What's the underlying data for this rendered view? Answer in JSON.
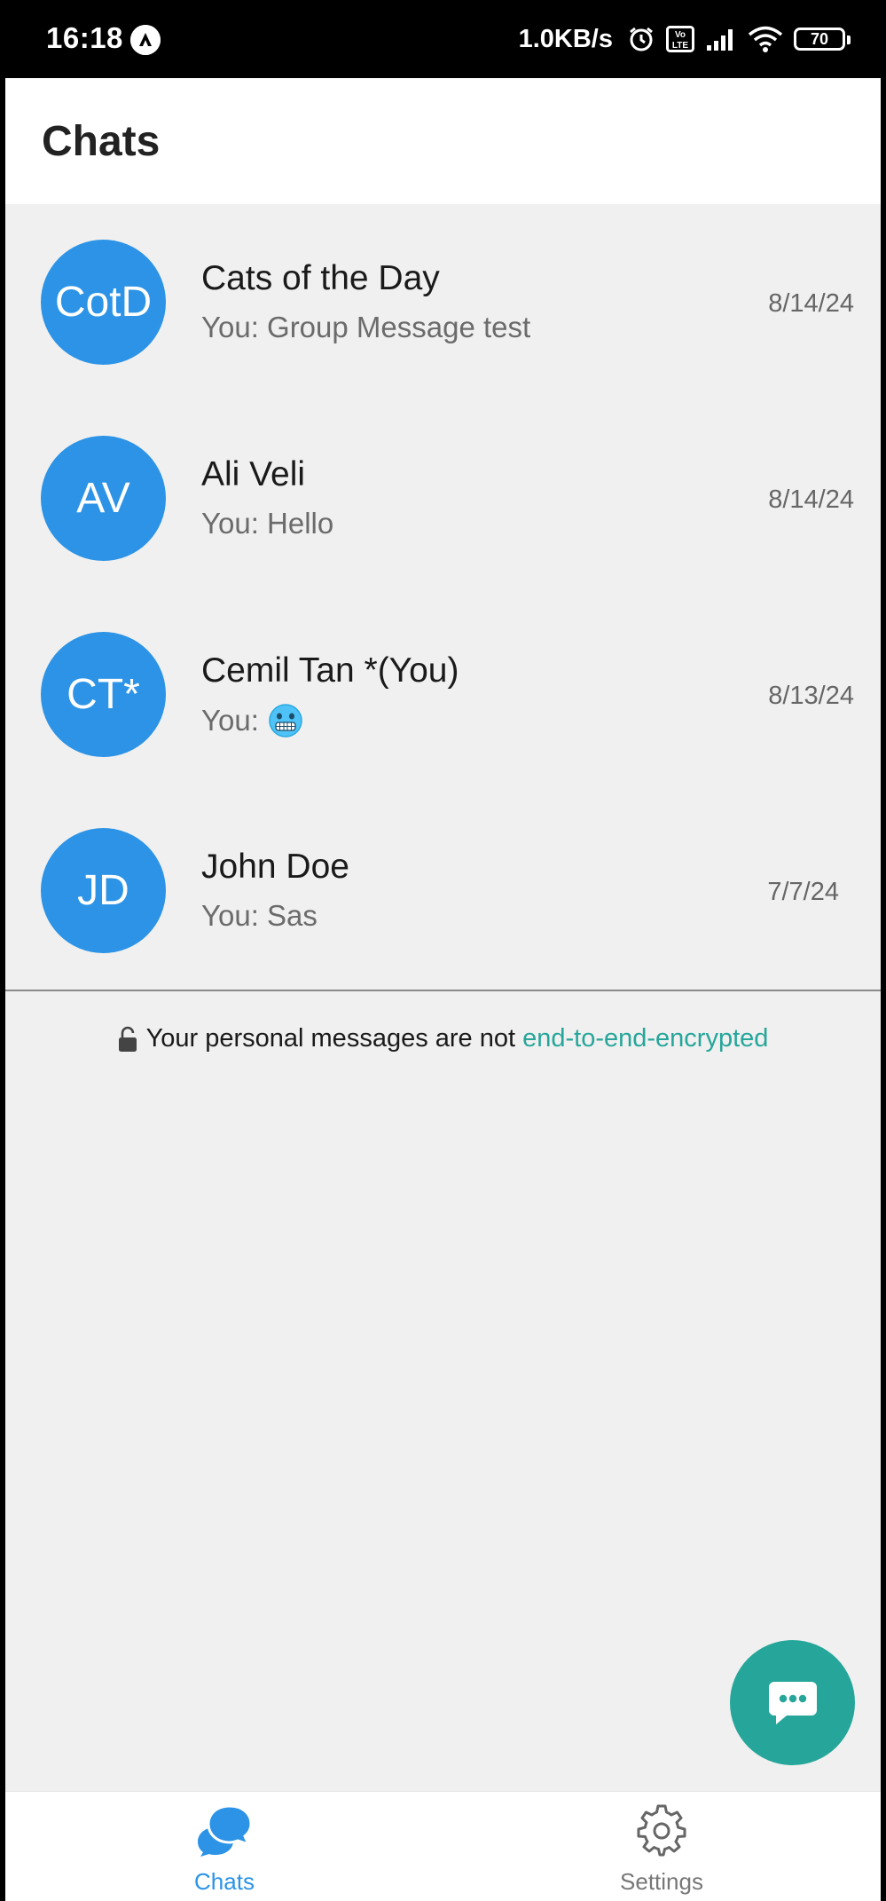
{
  "status_bar": {
    "time": "16:18",
    "speed": "1.0KB/s",
    "battery": "70",
    "volte": "Vo LTE"
  },
  "header": {
    "title": "Chats"
  },
  "chats": [
    {
      "initials": "CotD",
      "name": "Cats of the Day",
      "preview": "You: Group Message test",
      "date": "8/14/24"
    },
    {
      "initials": "AV",
      "name": "Ali Veli",
      "preview": "You: Hello",
      "date": "8/14/24"
    },
    {
      "initials": "CT*",
      "name": "Cemil Tan *(You)",
      "preview": "You:",
      "preview_emoji": "cold-face-emoji",
      "date": "8/13/24"
    },
    {
      "initials": "JD",
      "name": "John Doe",
      "preview": "You: Sas",
      "date": "7/7/24"
    }
  ],
  "notice": {
    "text": "Your personal messages are not",
    "link": "end-to-end-encrypted",
    "icon": "unlocked-lock-icon"
  },
  "fab": {
    "icon": "chat-bubble-icon"
  },
  "bottom_nav": {
    "items": [
      {
        "label": "Chats",
        "icon": "chats-icon",
        "active": true
      },
      {
        "label": "Settings",
        "icon": "gear-icon",
        "active": false
      }
    ]
  },
  "colors": {
    "avatar": "#2c93e6",
    "accent": "#26a69a",
    "nav_active": "#2c93e6",
    "background": "#f0f0f0"
  }
}
